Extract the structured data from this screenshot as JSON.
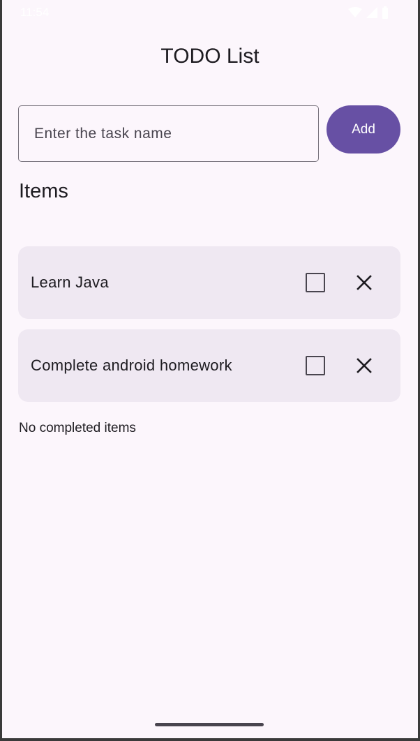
{
  "status_bar": {
    "time": "11:54"
  },
  "app": {
    "title": "TODO List"
  },
  "new_task": {
    "placeholder": "Enter the task name",
    "value": "",
    "add_label": "Add"
  },
  "items_section": {
    "heading": "Items"
  },
  "items": [
    {
      "label": "Learn Java",
      "checked": false
    },
    {
      "label": "Complete android homework",
      "checked": false
    }
  ],
  "completed": {
    "empty_text": "No completed items"
  },
  "colors": {
    "accent": "#6750a4",
    "background": "#fcf6fc",
    "card": "#efe8f2"
  }
}
